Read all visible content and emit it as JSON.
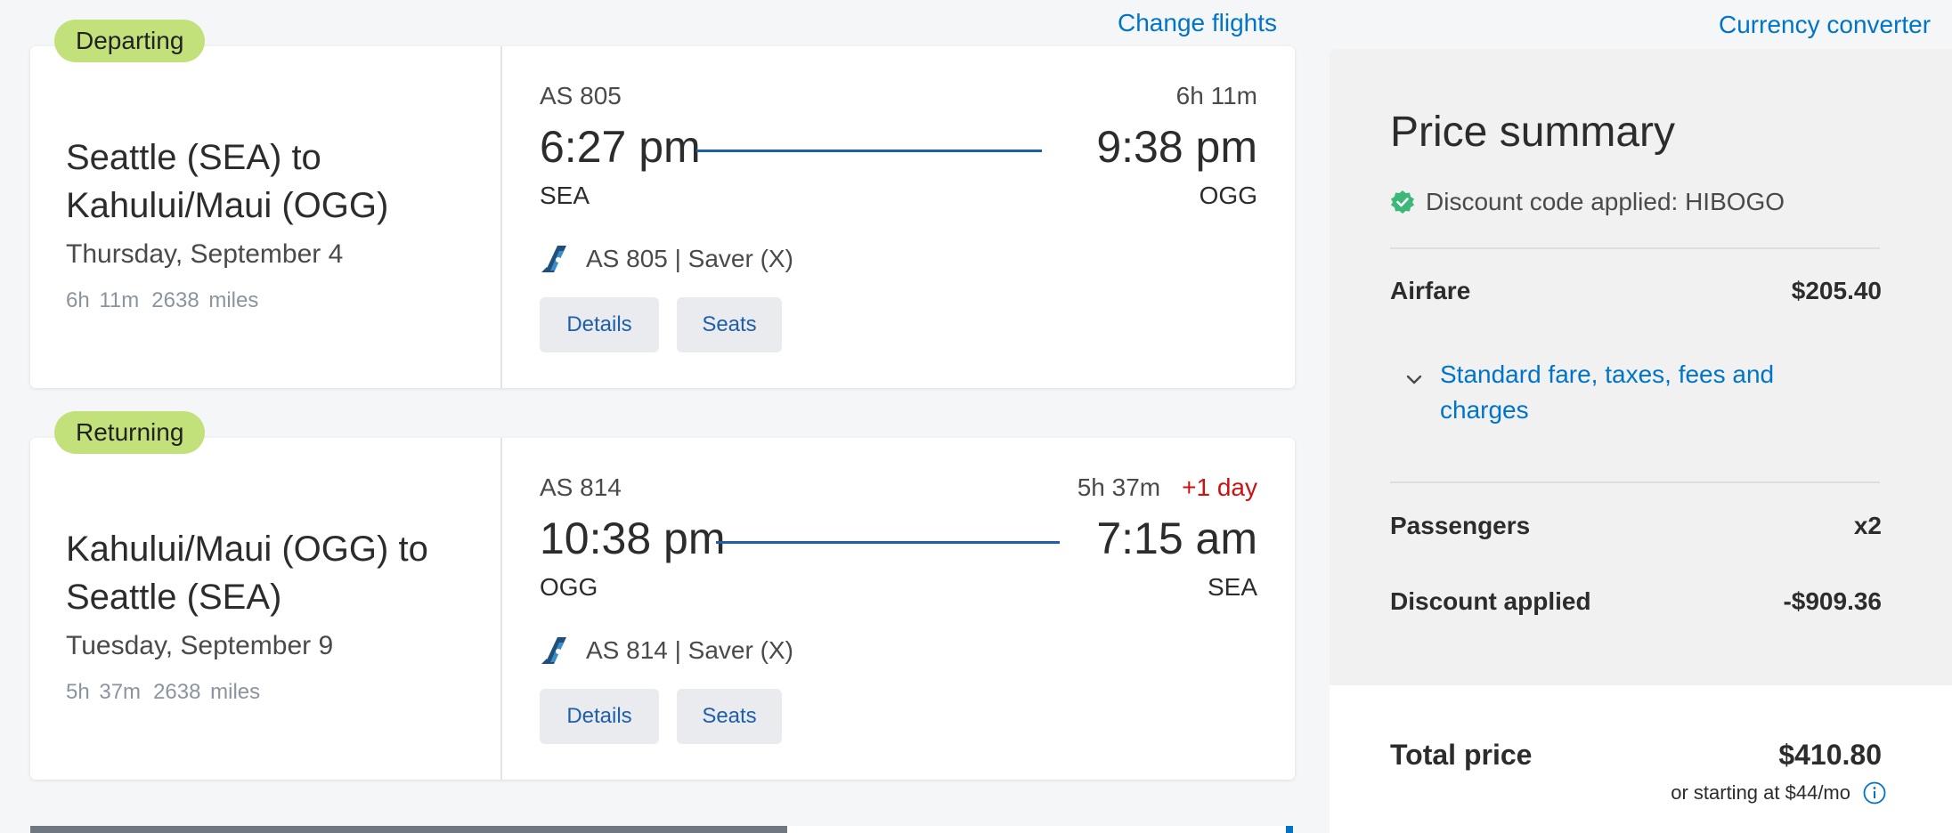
{
  "header": {
    "change_flights": "Change flights",
    "currency_converter": "Currency converter"
  },
  "departing": {
    "tag": "Departing",
    "route": "Seattle (SEA) to Kahului/Maui (OGG)",
    "date": "Thursday, September 4",
    "duration": "6h 11m",
    "distance": "2638 miles",
    "flight_number": "AS 805",
    "flight_duration": "6h 11m",
    "plus_day": "",
    "depart_time": "6:27 pm",
    "arrive_time": "9:38 pm",
    "origin_code": "SEA",
    "dest_code": "OGG",
    "fare": "AS 805 | Saver (X)",
    "details_label": "Details",
    "seats_label": "Seats"
  },
  "returning": {
    "tag": "Returning",
    "route": "Kahului/Maui (OGG) to Seattle (SEA)",
    "date": "Tuesday, September 9",
    "duration": "5h 37m",
    "distance": "2638 miles",
    "flight_number": "AS 814",
    "flight_duration": "5h 37m",
    "plus_day": "+1 day",
    "depart_time": "10:38 pm",
    "arrive_time": "7:15 am",
    "origin_code": "OGG",
    "dest_code": "SEA",
    "fare": "AS 814 | Saver (X)",
    "details_label": "Details",
    "seats_label": "Seats"
  },
  "summary": {
    "title": "Price summary",
    "discount_code_text": "Discount code applied: HIBOGO",
    "airfare_label": "Airfare",
    "airfare_value": "$205.40",
    "fare_breakdown_link": "Standard fare, taxes, fees and charges",
    "passengers_label": "Passengers",
    "passengers_value": "x2",
    "discount_label": "Discount applied",
    "discount_value": "-$909.36",
    "total_label": "Total price",
    "total_value": "$410.80",
    "financing_text": "or starting at $44/mo"
  },
  "colors": {
    "accent": "#0074c8",
    "pill": "#c2e17a",
    "route_line": "#1f5fa8",
    "plus_day": "#cc1111",
    "discount_badge": "#3cb878"
  }
}
